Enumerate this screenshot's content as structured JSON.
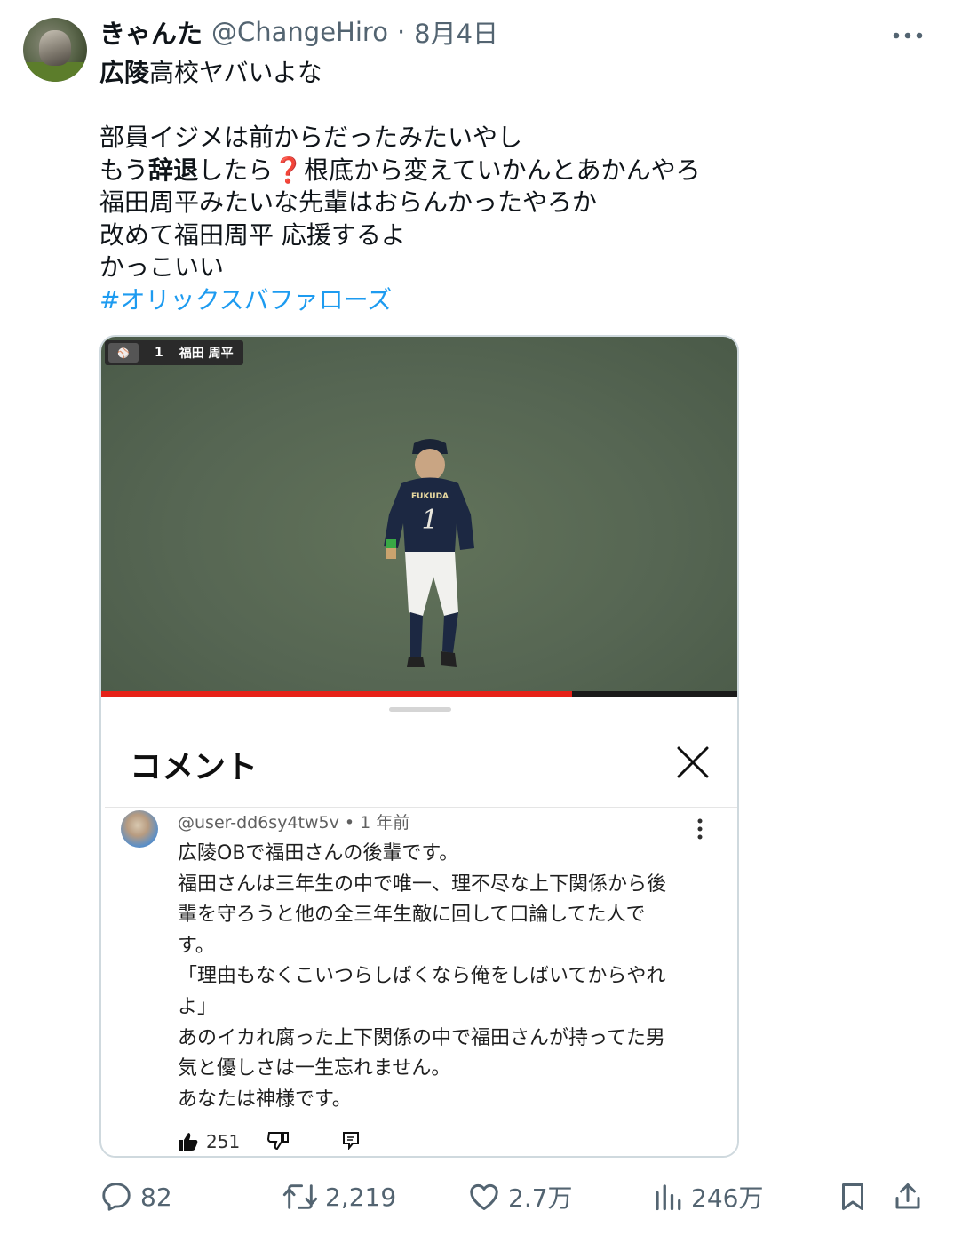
{
  "post": {
    "display_name": "きゃんた",
    "handle": "@ChangeHiro",
    "separator": "·",
    "date": "8月4日",
    "more_icon": "more-icon",
    "text": {
      "line1_bold": "広陵",
      "line1_rest": "高校ヤバいよな",
      "line2": "部員イジメは前からだったみたいやし",
      "line3_pre": "もう",
      "line3_bold": "辞退",
      "line3_mid": "したら",
      "line3_emoji": "❓",
      "line3_post": "根底から変えていかんとあかんやろ",
      "line4": "福田周平みたいな先輩はおらんかったやろか",
      "line5": "改めて福田周平 応援するよ",
      "line6": "かっこいい",
      "hashtag": "#オリックスバファローズ"
    }
  },
  "media": {
    "scorebug": {
      "number": "1",
      "player_name": "福田 周平"
    },
    "jersey_name": "FUKUDA",
    "jersey_number": "1",
    "video_progress": 0.74,
    "comments_sheet": {
      "title": "コメント",
      "close_icon": "close-icon",
      "comment": {
        "author": "@user-dd6sy4tw5v",
        "separator": "•",
        "time": "1 年前",
        "lines": [
          "広陵OBで福田さんの後輩です。",
          "福田さんは三年生の中で唯一、理不尽な上下関係から後",
          "輩を守ろうと他の全三年生敵に回して口論してた人で",
          "す。",
          "「理由もなくこいつらしばくなら俺をしばいてからやれ",
          "よ」",
          "あのイカれ腐った上下関係の中で福田さんが持ってた男",
          "気と優しさは一生忘れません。",
          "あなたは神様です。"
        ],
        "like_count": "251"
      }
    }
  },
  "actions": {
    "replies": "82",
    "reposts": "2,219",
    "likes": "2.7万",
    "views": "246万"
  },
  "colors": {
    "text": "#0f1419",
    "secondary": "#536471",
    "accent": "#1d9bf0",
    "border": "#cfd9de",
    "progress_red": "#e62117"
  }
}
